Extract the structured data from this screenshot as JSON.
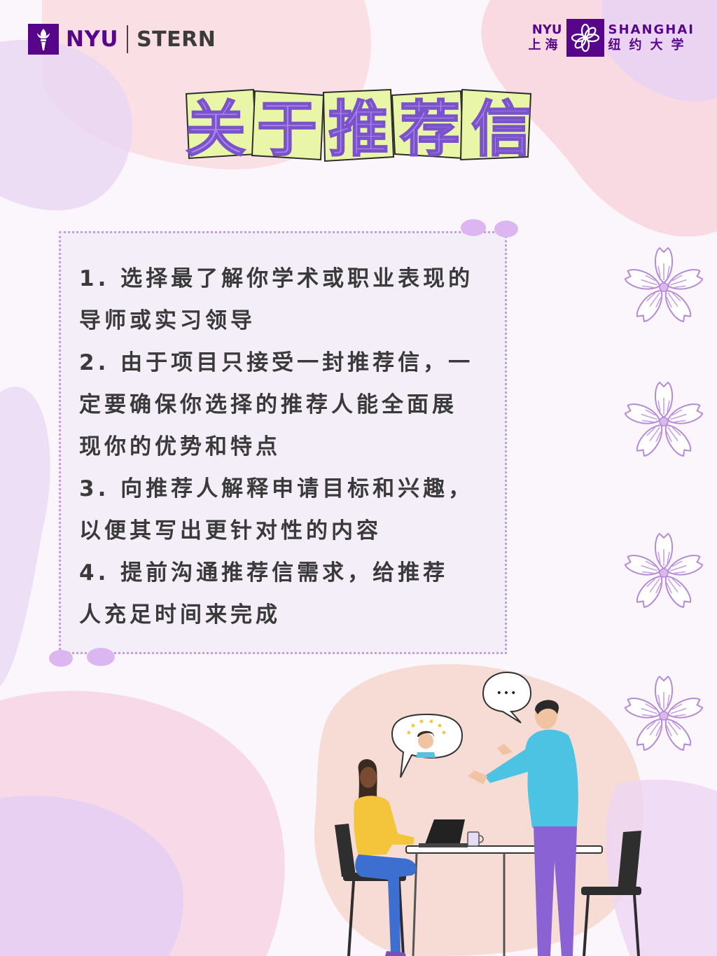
{
  "logos": {
    "stern": {
      "nyu": "NYU",
      "stern": "STERN",
      "icon": "nyu-torch-icon"
    },
    "shanghai": {
      "nyu": "NYU",
      "cn_city": "上海",
      "en_name": "SHANGHAI",
      "cn_name": "纽约大学",
      "icon": "nyu-shanghai-emblem-icon"
    }
  },
  "title": {
    "chars": [
      "关",
      "于",
      "推",
      "荐",
      "信"
    ]
  },
  "content": {
    "lines": [
      "1. 选择最了解你学术或职业表现的",
      "导师或实习领导",
      "2. 由于项目只接受一封推荐信，一",
      "定要确保你选择的推荐人能全面展",
      "现你的优势和特点",
      "3. 向推荐人解释申请目标和兴趣，",
      "以便其写出更针对性的内容",
      "4. 提前沟通推荐信需求，给推荐",
      "人充足时间来完成"
    ]
  },
  "decor": {
    "flower_icon": "cherry-blossom-icon"
  },
  "illustration": {
    "speech_dots": "•••"
  },
  "colors": {
    "brand_purple": "#57068c",
    "title_fill": "#a884f0",
    "title_backing": "#e9f6a8",
    "card_bg": "#f3eef7",
    "card_border": "#c59de6",
    "text": "#3a3a3a"
  }
}
